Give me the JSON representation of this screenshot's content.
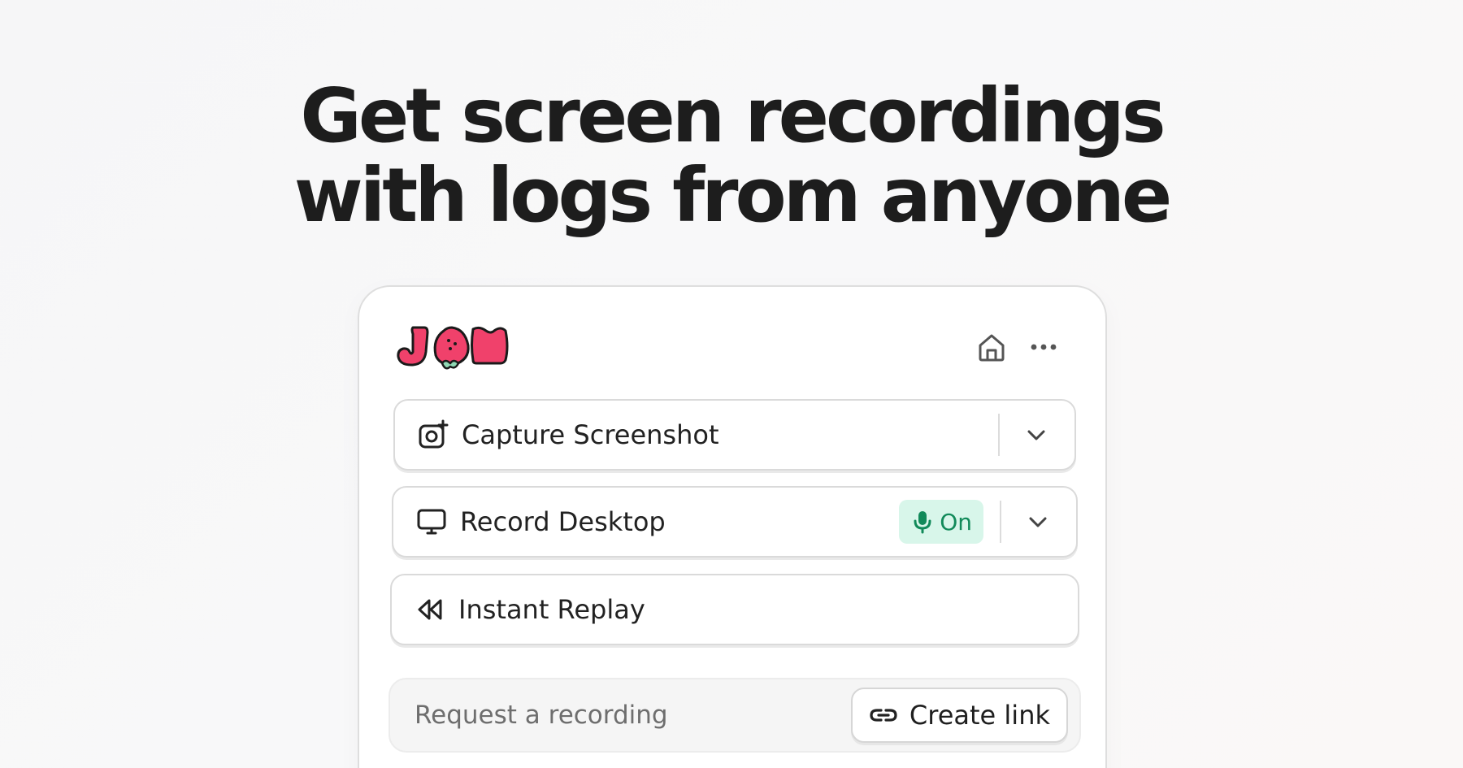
{
  "headline": {
    "line1": "Get screen recordings",
    "line2": "with logs from anyone"
  },
  "brand": {
    "logo_text": "JAM",
    "logo_colors": {
      "primary": "#f0416b",
      "leaf": "#8fd8b4",
      "outline": "#1a1a1a"
    }
  },
  "header_icons": [
    "home-icon",
    "more-icon"
  ],
  "actions": [
    {
      "label": "Capture Screenshot",
      "icon": "camera-plus-icon",
      "has_dropdown": true
    },
    {
      "label": "Record Desktop",
      "icon": "monitor-icon",
      "has_dropdown": true,
      "mic_badge": {
        "icon": "microphone-icon",
        "text": "On"
      }
    },
    {
      "label": "Instant Replay",
      "icon": "rewind-icon",
      "has_dropdown": false
    }
  ],
  "request": {
    "placeholder": "Request a recording",
    "button_label": "Create link",
    "button_icon": "link-icon"
  },
  "colors": {
    "accent_green_bg": "#d8f6ea",
    "accent_green_text": "#128a5a",
    "text_dark": "#1d1d1d"
  }
}
